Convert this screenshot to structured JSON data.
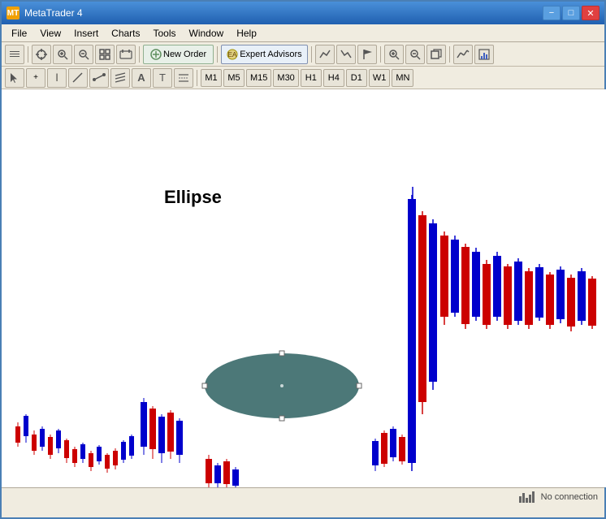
{
  "titleBar": {
    "title": "MetaTrader 4",
    "iconLabel": "MT",
    "minimizeLabel": "−",
    "maximizeLabel": "□",
    "closeLabel": "✕"
  },
  "menuBar": {
    "items": [
      {
        "label": "File",
        "id": "file"
      },
      {
        "label": "View",
        "id": "view"
      },
      {
        "label": "Insert",
        "id": "insert"
      },
      {
        "label": "Charts",
        "id": "charts"
      },
      {
        "label": "Tools",
        "id": "tools"
      },
      {
        "label": "Window",
        "id": "window"
      },
      {
        "label": "Help",
        "id": "help"
      }
    ]
  },
  "toolbar1": {
    "newOrderLabel": "New Order",
    "expertAdvisorsLabel": "Expert Advisors"
  },
  "toolbar2": {
    "timeframes": [
      "M1",
      "M5",
      "M15",
      "M30",
      "H1",
      "H4",
      "D1",
      "W1",
      "MN"
    ]
  },
  "chart": {
    "ellipseLabel": "Ellipse"
  },
  "statusBar": {
    "connectionLabel": "No connection"
  }
}
